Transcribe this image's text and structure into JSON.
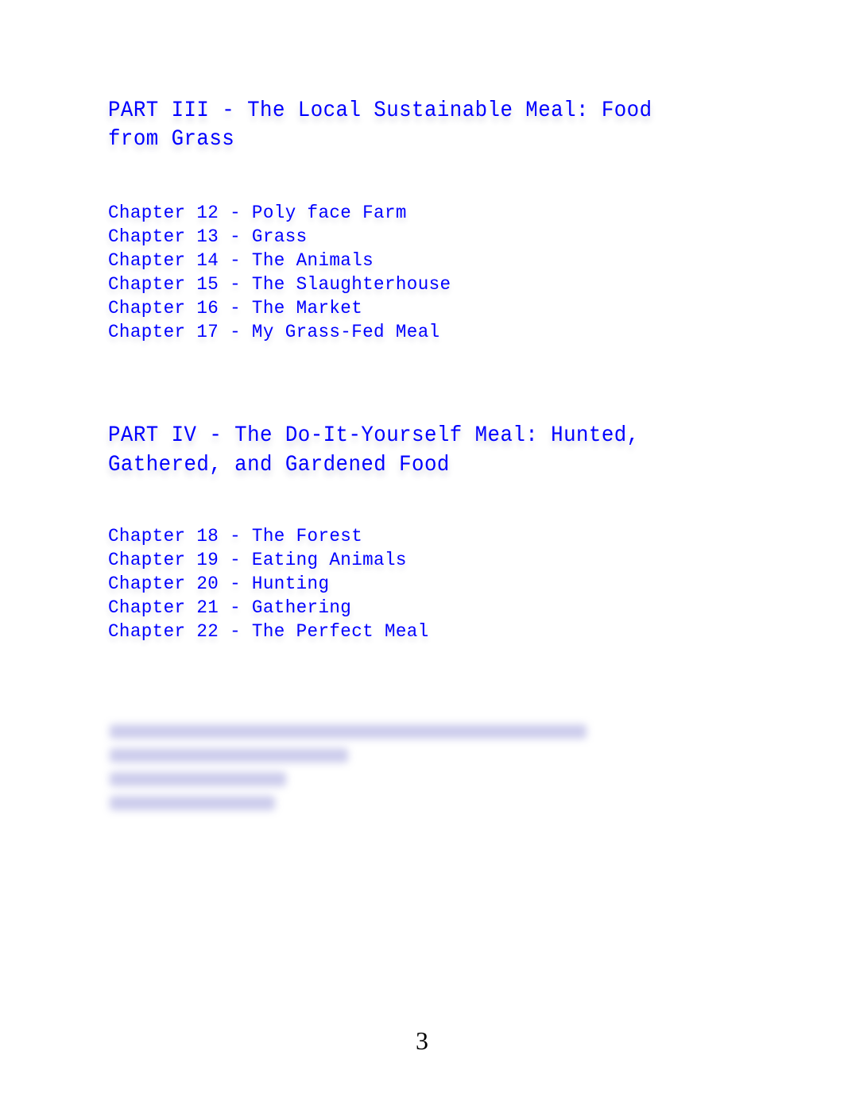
{
  "document": {
    "text_color": "#0000ff",
    "sections": [
      {
        "title": "PART III - The Local Sustainable Meal: Food from Grass",
        "chapters": [
          "Chapter 12 - Poly face Farm",
          "Chapter 13 - Grass",
          "Chapter 14 - The Animals",
          "Chapter 15 - The Slaughterhouse",
          "Chapter 16 - The Market",
          "Chapter 17 - My Grass-Fed Meal"
        ]
      },
      {
        "title": "PART IV - The Do-It-Yourself Meal: Hunted, Gathered, and Gardened Food",
        "chapters": [
          "Chapter 18 - The Forest",
          "Chapter 19 - Eating Animals",
          "Chapter 20 - Hunting",
          "Chapter 21 - Gathering",
          "Chapter 22 - The Perfect Meal"
        ]
      }
    ],
    "blurred_block": {
      "line_count": 4,
      "note": "obscured text"
    },
    "page_number": "3"
  }
}
